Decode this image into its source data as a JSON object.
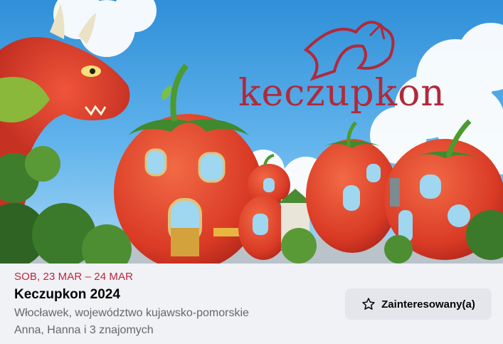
{
  "event": {
    "date": "SOB, 23 MAR – 24 MAR",
    "title": "Keczupkon 2024",
    "location": "Włocławek, województwo kujawsko-pomorskie",
    "friends": "Anna, Hanna i 3 znajomych"
  },
  "cover": {
    "logo_text": "keczupkon"
  },
  "interest_button": {
    "label": "Zainteresowany(a)",
    "icon": "star-icon"
  },
  "colors": {
    "date_accent": "#c0243e",
    "logo": "#b02a3a",
    "button_bg": "#e4e6eb",
    "panel_bg": "#f0f2f5"
  }
}
